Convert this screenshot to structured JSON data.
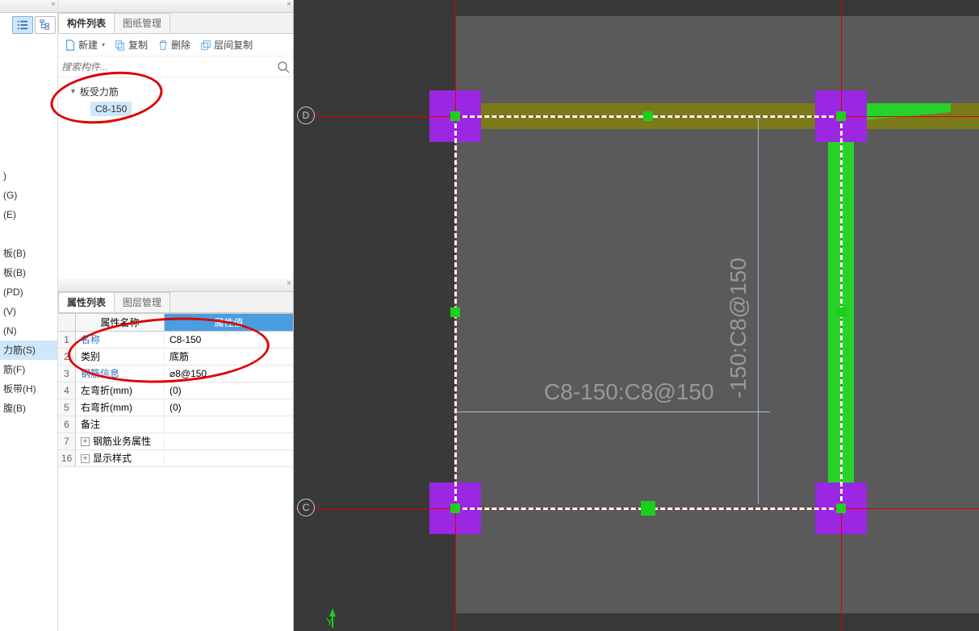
{
  "left_nav": {
    "items": [
      ")",
      "(G)",
      "(E)",
      "",
      "板(B)",
      "板(B)",
      "(PD)",
      "(V)",
      "(N)",
      "力筋(S)",
      "筋(F)",
      "板带(H)",
      "腹(B)"
    ],
    "selected_index": 9
  },
  "component_panel": {
    "tabs": {
      "list": "构件列表",
      "drawings": "图纸管理"
    },
    "toolbar": {
      "new": "新建",
      "copy": "复制",
      "delete": "删除",
      "layer_copy": "层间复制"
    },
    "search_placeholder": "搜索构件...",
    "tree": {
      "root": "板受力筋",
      "child": "C8-150"
    }
  },
  "property_panel": {
    "tabs": {
      "props": "属性列表",
      "layers": "图层管理"
    },
    "header": {
      "name": "属性名称",
      "value": "属性值"
    },
    "rows": [
      {
        "n": "1",
        "name": "名称",
        "value": "C8-150",
        "link": true
      },
      {
        "n": "2",
        "name": "类别",
        "value": "底筋"
      },
      {
        "n": "3",
        "name": "钢筋信息",
        "value": "⌀8@150",
        "link": true
      },
      {
        "n": "4",
        "name": "左弯折(mm)",
        "value": "(0)"
      },
      {
        "n": "5",
        "name": "右弯折(mm)",
        "value": "(0)"
      },
      {
        "n": "6",
        "name": "备注",
        "value": ""
      },
      {
        "n": "7",
        "name": "钢筋业务属性",
        "value": "",
        "expand": true
      },
      {
        "n": "16",
        "name": "显示样式",
        "value": "",
        "expand": true
      }
    ]
  },
  "canvas": {
    "grid_labels": {
      "row_top": "D",
      "row_bottom": "C"
    },
    "rebar_label_h": "C8-150:C8@150",
    "rebar_label_v": "-150:C8@150",
    "y_axis": "Y"
  }
}
